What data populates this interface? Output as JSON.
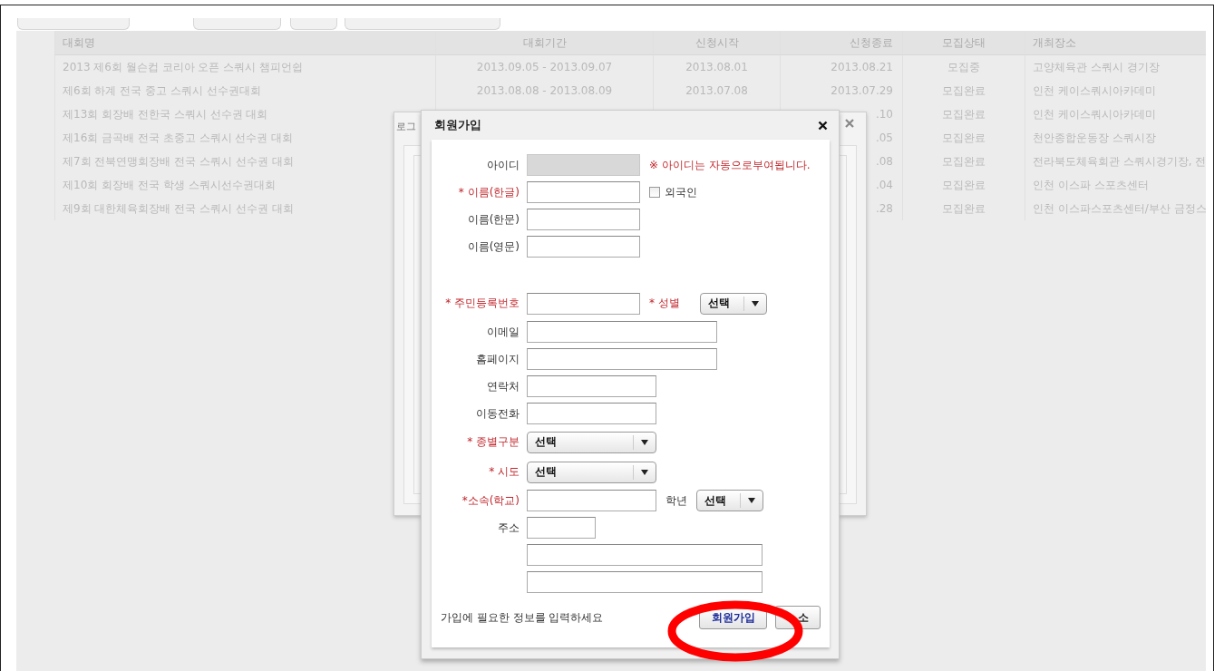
{
  "background_table": {
    "columns": [
      "대회명",
      "대회기간",
      "신청시작",
      "신청종료",
      "모집상태",
      "개최장소"
    ],
    "rows": [
      [
        "2013 제6회 월슨컵 코리아 오픈 스쿼시 챔피언쉽",
        "2013.09.05 - 2013.09.07",
        "2013.08.01",
        "2013.08.21",
        "모집중",
        "고양체육관 스쿼시 경기장"
      ],
      [
        "제6회 하계 전국 중고 스쿼시 선수권대회",
        "2013.08.08 - 2013.08.09",
        "2013.07.08",
        "2013.07.29",
        "모집완료",
        "인천 케이스쿼시아카데미"
      ],
      [
        "제13회 회장배 전한국 스쿼시 선수권 대회",
        "",
        "",
        ".10",
        "모집완료",
        "인천 케이스쿼시아카데미"
      ],
      [
        "제16회 금곡배 전국 초중고 스쿼시 선수권 대회",
        "",
        "",
        ".05",
        "모집완료",
        "천안종합운동장 스쿼시장"
      ],
      [
        "제7회 전북연맹회장배 전국 스쿼시 선수권 대회",
        "",
        "",
        ".08",
        "모집완료",
        "전라북도체육회관 스쿼시경기장, 전"
      ],
      [
        "제10회 회장배 전국 학생 스쿼시선수권대회",
        "",
        "",
        ".04",
        "모집완료",
        "인천 이스파 스포츠센터"
      ],
      [
        "제9회 대한체육회장배 전국 스쿼시 선수권 대회",
        "",
        "",
        ".28",
        "모집완료",
        "인천 이스파스포츠센터/부산 금정스"
      ]
    ]
  },
  "login_dialog": {
    "title": "로그"
  },
  "signup_dialog": {
    "title": "회원가입",
    "fields": [
      {
        "kind": "input",
        "label": "아이디",
        "required": false,
        "disabled": true,
        "note": "※ 아이디는 자동으로부여됩니다."
      },
      {
        "kind": "input",
        "label": "* 이름(한글)",
        "required": true,
        "disabled": false,
        "checkbox": {
          "label": "외국인",
          "checked": false
        }
      },
      {
        "kind": "input",
        "label": "이름(한문)",
        "required": false,
        "disabled": false
      },
      {
        "kind": "input",
        "label": "이름(영문)",
        "required": false,
        "disabled": false
      },
      {
        "kind": "input",
        "label": "* 주민등록번호",
        "required": true,
        "disabled": false,
        "extra": {
          "label": "* 성별",
          "required": true,
          "value": "선택"
        }
      },
      {
        "kind": "input",
        "label": "이메일",
        "required": false,
        "disabled": false
      },
      {
        "kind": "input",
        "label": "홈페이지",
        "required": false,
        "disabled": false
      },
      {
        "kind": "input",
        "label": "연락처",
        "required": false,
        "disabled": false
      },
      {
        "kind": "input",
        "label": "이동전화",
        "required": false,
        "disabled": false
      },
      {
        "kind": "select",
        "label": "* 종별구분",
        "required": true,
        "value": "선택"
      },
      {
        "kind": "select",
        "label": "* 시도",
        "required": true,
        "value": "선택"
      },
      {
        "kind": "input",
        "label": "*소속(학교)",
        "required": true,
        "disabled": false,
        "extra": {
          "label": "학년",
          "required": false,
          "value": "선택"
        }
      },
      {
        "kind": "input",
        "label": "주소",
        "required": false,
        "disabled": false
      },
      {
        "kind": "input",
        "disabled": false
      },
      {
        "kind": "input",
        "disabled": false
      }
    ],
    "hint": "가입에 필요한 정보를 입력하세요",
    "submit_button": "회원가입",
    "cancel_button": "소"
  }
}
